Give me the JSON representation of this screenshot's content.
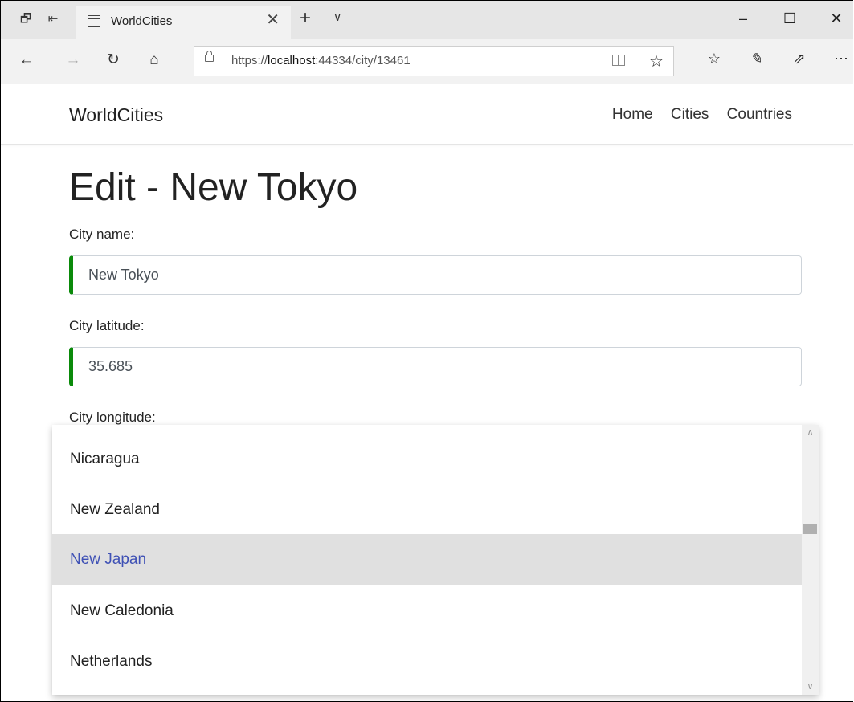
{
  "browser": {
    "tab_title": "WorldCities",
    "url_prefix": "https://",
    "url_host": "localhost",
    "url_rest": ":44334/city/13461"
  },
  "app": {
    "brand": "WorldCities",
    "nav": [
      "Home",
      "Cities",
      "Countries"
    ]
  },
  "form": {
    "title": "Edit - New Tokyo",
    "name_label": "City name:",
    "name_value": "New Tokyo",
    "lat_label": "City latitude:",
    "lat_value": "35.685",
    "lon_label": "City longitude:"
  },
  "dropdown": {
    "options": [
      "Nicaragua",
      "New Zealand",
      "New Japan",
      "New Caledonia",
      "Netherlands"
    ],
    "selected": "New Japan"
  },
  "icons": {
    "tab_actions": "tabs-aside-icon",
    "back_tabs": "set-tabs-aside-icon",
    "page": "page-icon",
    "close": "close-icon",
    "new_tab": "plus-icon",
    "tab_menu": "chevron-down-icon",
    "minimize": "minimize-icon",
    "maximize": "maximize-icon",
    "window_close": "window-close-icon",
    "back": "back-arrow-icon",
    "forward": "forward-arrow-icon",
    "refresh": "refresh-icon",
    "home": "home-icon",
    "lock": "lock-icon",
    "reader": "reading-view-icon",
    "favorite": "star-icon",
    "favorites": "favorites-icon",
    "pen": "pen-icon",
    "share": "share-icon",
    "more": "more-icon"
  },
  "colors": {
    "valid_border": "#0a8a0a",
    "selected_text": "#3f51b5",
    "selected_bg": "#e0e0e0"
  }
}
